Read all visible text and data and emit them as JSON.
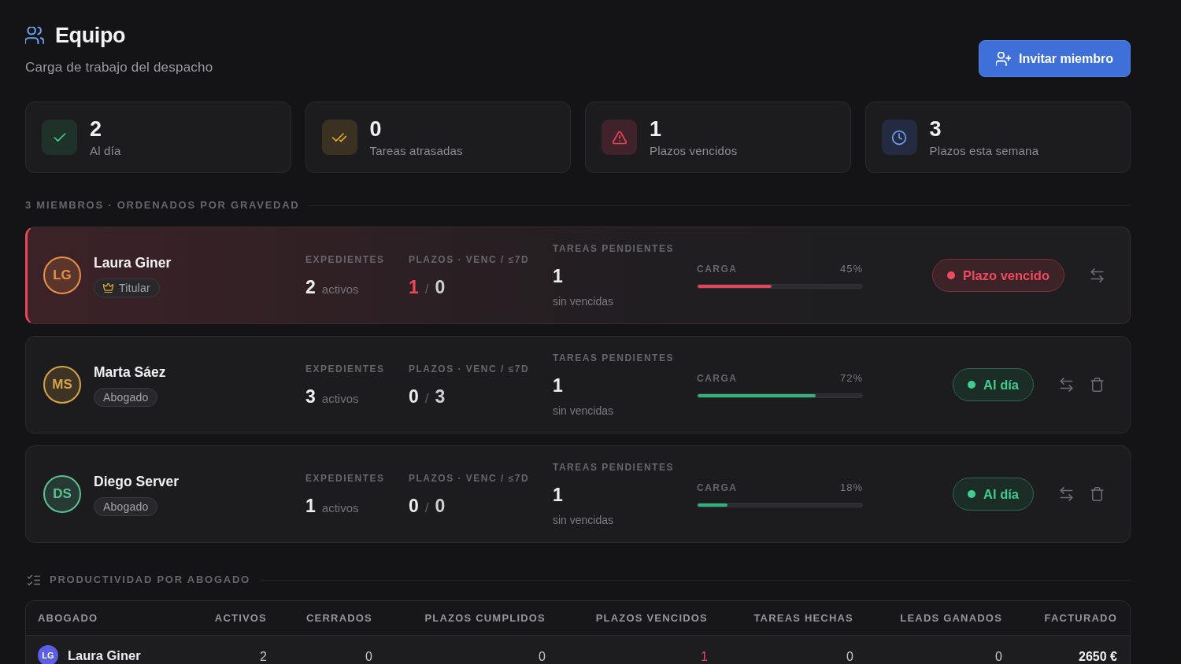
{
  "header": {
    "title": "Equipo",
    "subtitle": "Carga de trabajo del despacho",
    "invite_button": "Invitar miembro"
  },
  "stats": [
    {
      "kind": "ok",
      "value": "2",
      "label": "Al día"
    },
    {
      "kind": "late_tasks",
      "value": "0",
      "label": "Tareas atrasadas"
    },
    {
      "kind": "overdue",
      "value": "1",
      "label": "Plazos vencidos"
    },
    {
      "kind": "week",
      "value": "3",
      "label": "Plazos esta semana"
    }
  ],
  "members_section": {
    "title": "3 MIEMBROS · ORDENADOS POR GRAVEDAD"
  },
  "members": [
    {
      "initials": "LG",
      "color": "#e8914a",
      "name": "Laura Giner",
      "role": {
        "label": "Titular",
        "owner": true
      },
      "files": {
        "label": "EXPEDIENTES",
        "value": "2",
        "unit": "activos"
      },
      "deadlines": {
        "label": "PLAZOS · VENC / ≤7D",
        "overdue": "1",
        "overdue_flagged": true,
        "separator": "/",
        "this_week": "0"
      },
      "tasks": {
        "label": "TAREAS PENDIENTES",
        "value": "1",
        "note": "sin vencidas"
      },
      "load": {
        "label": "CARGA",
        "reading": "45%",
        "level": 0.45
      },
      "status": {
        "kind": "overdue",
        "label": "Plazo vencido"
      },
      "actions": [
        {
          "kind": "transfer"
        }
      ]
    },
    {
      "initials": "MS",
      "color": "#d6a446",
      "name": "Marta Sáez",
      "role": {
        "label": "Abogado",
        "owner": false
      },
      "files": {
        "label": "EXPEDIENTES",
        "value": "3",
        "unit": "activos"
      },
      "deadlines": {
        "label": "PLAZOS · VENC / ≤7D",
        "overdue": "0",
        "overdue_flagged": false,
        "separator": "/",
        "this_week": "3"
      },
      "tasks": {
        "label": "TAREAS PENDIENTES",
        "value": "1",
        "note": "sin vencidas"
      },
      "load": {
        "label": "CARGA",
        "reading": "72%",
        "level": 0.72
      },
      "status": {
        "kind": "ok",
        "label": "Al día"
      },
      "actions": [
        {
          "kind": "transfer"
        },
        {
          "kind": "delete"
        }
      ]
    },
    {
      "initials": "DS",
      "color": "#5ec193",
      "name": "Diego Server",
      "role": {
        "label": "Abogado",
        "owner": false
      },
      "files": {
        "label": "EXPEDIENTES",
        "value": "1",
        "unit": "activos"
      },
      "deadlines": {
        "label": "PLAZOS · VENC / ≤7D",
        "overdue": "0",
        "overdue_flagged": false,
        "separator": "/",
        "this_week": "0"
      },
      "tasks": {
        "label": "TAREAS PENDIENTES",
        "value": "1",
        "note": "sin vencidas"
      },
      "load": {
        "label": "CARGA",
        "reading": "18%",
        "level": 0.18
      },
      "status": {
        "kind": "ok",
        "label": "Al día"
      },
      "actions": [
        {
          "kind": "transfer"
        },
        {
          "kind": "delete"
        }
      ]
    }
  ],
  "productivity": {
    "title": "PRODUCTIVIDAD POR ABOGADO",
    "columns": [
      "ABOGADO",
      "ACTIVOS",
      "CERRADOS",
      "PLAZOS CUMPLIDOS",
      "PLAZOS VENCIDOS",
      "TAREAS HECHAS",
      "LEADS GANADOS",
      "FACTURADO"
    ],
    "rows": [
      {
        "initials": "LG",
        "name": "Laura Giner",
        "active": "2",
        "closed": "0",
        "deadlines_met": "0",
        "deadlines_missed": "1",
        "missed_flagged": true,
        "tasks_done": "0",
        "leads_won": "0",
        "billed": "2650 €"
      }
    ]
  }
}
